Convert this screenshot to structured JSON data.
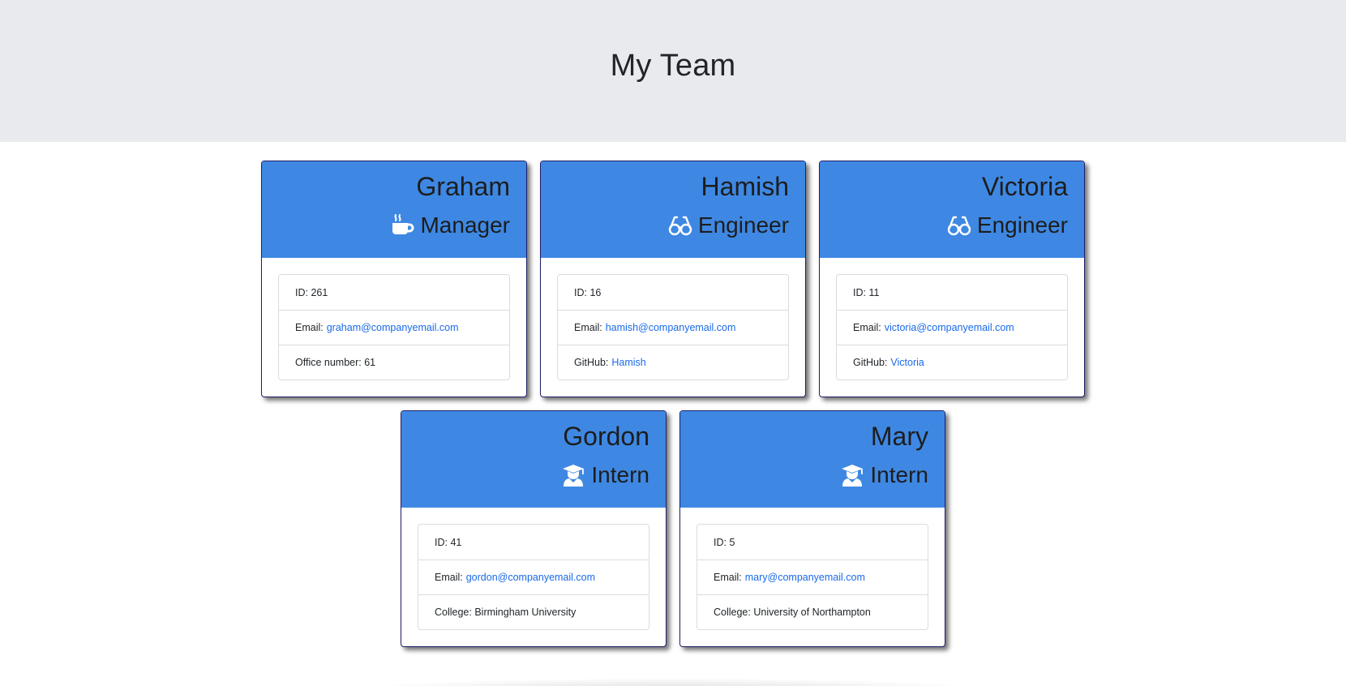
{
  "header": {
    "title": "My Team"
  },
  "colors": {
    "card_header": "#3e88e3",
    "link": "#1a6ae8",
    "page_header": "#e9eaed"
  },
  "cards": [
    {
      "name": "Graham",
      "role": "Manager",
      "icon": "mug-icon",
      "id_text": "ID: 261",
      "email_label": "Email:",
      "email": "graham@companyemail.com",
      "extra_label": "Office number: 61",
      "extra_value": ""
    },
    {
      "name": "Hamish",
      "role": "Engineer",
      "icon": "glasses-icon",
      "id_text": "ID: 16",
      "email_label": "Email:",
      "email": "hamish@companyemail.com",
      "extra_label": "GitHub:",
      "extra_value": "Hamish"
    },
    {
      "name": "Victoria",
      "role": "Engineer",
      "icon": "glasses-icon",
      "id_text": "ID: 11",
      "email_label": "Email:",
      "email": "victoria@companyemail.com",
      "extra_label": "GitHub:",
      "extra_value": "Victoria"
    },
    {
      "name": "Gordon",
      "role": "Intern",
      "icon": "graduate-icon",
      "id_text": "ID: 41",
      "email_label": "Email:",
      "email": "gordon@companyemail.com",
      "extra_label": "College: Birmingham University",
      "extra_value": ""
    },
    {
      "name": "Mary",
      "role": "Intern",
      "icon": "graduate-icon",
      "id_text": "ID: 5",
      "email_label": "Email:",
      "email": "mary@companyemail.com",
      "extra_label": "College: University of Northampton",
      "extra_value": ""
    }
  ]
}
